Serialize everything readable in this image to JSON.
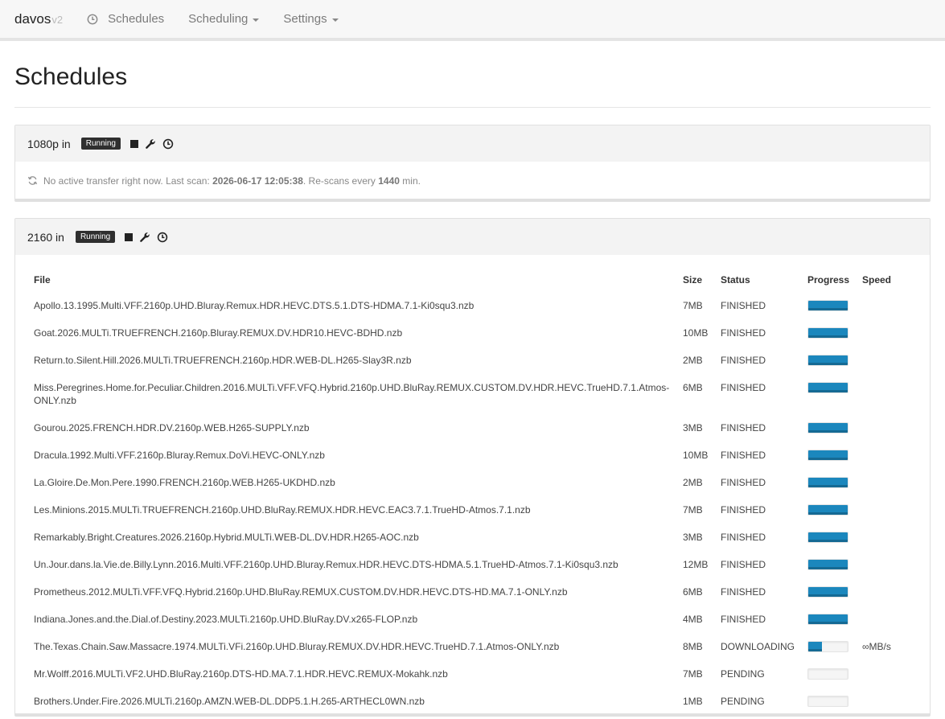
{
  "navbar": {
    "brand": "davos",
    "version": "v2",
    "items": [
      {
        "label": "Schedules",
        "icon": "clock-icon"
      },
      {
        "label": "Scheduling",
        "dropdown": true
      },
      {
        "label": "Settings",
        "dropdown": true
      }
    ]
  },
  "page": {
    "title": "Schedules"
  },
  "schedules": [
    {
      "name": "1080p in",
      "status": "Running",
      "message_pre": "No active transfer right now. Last scan: ",
      "last_scan": "2026-06-17 12:05:38",
      "message_mid": ". Re-scans every ",
      "interval": "1440",
      "message_post": " min."
    },
    {
      "name": "2160 in",
      "status": "Running",
      "table": {
        "headers": {
          "file": "File",
          "size": "Size",
          "status": "Status",
          "progress": "Progress",
          "speed": "Speed"
        },
        "rows": [
          {
            "file": "Apollo.13.1995.Multi.VFF.2160p.UHD.Bluray.Remux.HDR.HEVC.DTS.5.1.DTS-HDMA.7.1-Ki0squ3.nzb",
            "size": "7MB",
            "status": "FINISHED",
            "progress": 100,
            "speed": ""
          },
          {
            "file": "Goat.2026.MULTi.TRUEFRENCH.2160p.Bluray.REMUX.DV.HDR10.HEVC-BDHD.nzb",
            "size": "10MB",
            "status": "FINISHED",
            "progress": 100,
            "speed": ""
          },
          {
            "file": "Return.to.Silent.Hill.2026.MULTi.TRUEFRENCH.2160p.HDR.WEB-DL.H265-Slay3R.nzb",
            "size": "2MB",
            "status": "FINISHED",
            "progress": 100,
            "speed": ""
          },
          {
            "file": "Miss.Peregrines.Home.for.Peculiar.Children.2016.MULTi.VFF.VFQ.Hybrid.2160p.UHD.BluRay.REMUX.CUSTOM.DV.HDR.HEVC.TrueHD.7.1.Atmos-ONLY.nzb",
            "size": "6MB",
            "status": "FINISHED",
            "progress": 100,
            "speed": ""
          },
          {
            "file": "Gourou.2025.FRENCH.HDR.DV.2160p.WEB.H265-SUPPLY.nzb",
            "size": "3MB",
            "status": "FINISHED",
            "progress": 100,
            "speed": ""
          },
          {
            "file": "Dracula.1992.Multi.VFF.2160p.Bluray.Remux.DoVi.HEVC-ONLY.nzb",
            "size": "10MB",
            "status": "FINISHED",
            "progress": 100,
            "speed": ""
          },
          {
            "file": "La.Gloire.De.Mon.Pere.1990.FRENCH.2160p.WEB.H265-UKDHD.nzb",
            "size": "2MB",
            "status": "FINISHED",
            "progress": 100,
            "speed": ""
          },
          {
            "file": "Les.Minions.2015.MULTi.TRUEFRENCH.2160p.UHD.BluRay.REMUX.HDR.HEVC.EAC3.7.1.TrueHD-Atmos.7.1.nzb",
            "size": "7MB",
            "status": "FINISHED",
            "progress": 100,
            "speed": ""
          },
          {
            "file": "Remarkably.Bright.Creatures.2026.2160p.Hybrid.MULTi.WEB-DL.DV.HDR.H265-AOC.nzb",
            "size": "3MB",
            "status": "FINISHED",
            "progress": 100,
            "speed": ""
          },
          {
            "file": "Un.Jour.dans.la.Vie.de.Billy.Lynn.2016.Multi.VFF.2160p.UHD.Bluray.Remux.HDR.HEVC.DTS-HDMA.5.1.TrueHD-Atmos.7.1-Ki0squ3.nzb",
            "size": "12MB",
            "status": "FINISHED",
            "progress": 100,
            "speed": ""
          },
          {
            "file": "Prometheus.2012.MULTi.VFF.VFQ.Hybrid.2160p.UHD.BluRay.REMUX.CUSTOM.DV.HDR.HEVC.DTS-HD.MA.7.1-ONLY.nzb",
            "size": "6MB",
            "status": "FINISHED",
            "progress": 100,
            "speed": ""
          },
          {
            "file": "Indiana.Jones.and.the.Dial.of.Destiny.2023.MULTi.2160p.UHD.BluRay.DV.x265-FLOP.nzb",
            "size": "4MB",
            "status": "FINISHED",
            "progress": 100,
            "speed": ""
          },
          {
            "file": "The.Texas.Chain.Saw.Massacre.1974.MULTi.VFi.2160p.UHD.Bluray.REMUX.DV.HDR.HEVC.TrueHD.7.1.Atmos-ONLY.nzb",
            "size": "8MB",
            "status": "DOWNLOADING",
            "progress": 35,
            "speed": "∞MB/s"
          },
          {
            "file": "Mr.Wolff.2016.MULTi.VF2.UHD.BluRay.2160p.DTS-HD.MA.7.1.HDR.HEVC.REMUX-Mokahk.nzb",
            "size": "7MB",
            "status": "PENDING",
            "progress": 0,
            "speed": ""
          },
          {
            "file": "Brothers.Under.Fire.2026.MULTi.2160p.AMZN.WEB-DL.DDP5.1.H.265-ARTHECL0WN.nzb",
            "size": "1MB",
            "status": "PENDING",
            "progress": 0,
            "speed": ""
          }
        ]
      }
    }
  ],
  "colors": {
    "progress_fill": "#1b87bd",
    "badge_bg": "#2f2f2f"
  }
}
